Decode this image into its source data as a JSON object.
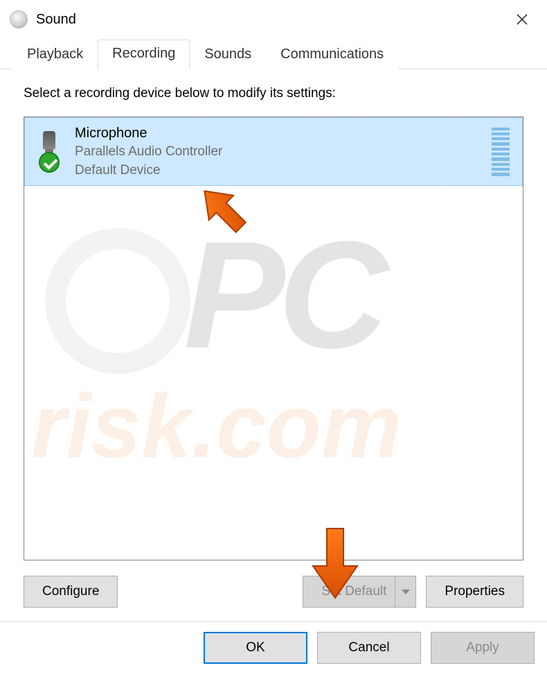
{
  "window": {
    "title": "Sound"
  },
  "tabs": {
    "playback": "Playback",
    "recording": "Recording",
    "sounds": "Sounds",
    "communications": "Communications",
    "active": "recording"
  },
  "instruction": "Select a recording device below to modify its settings:",
  "device": {
    "name": "Microphone",
    "controller": "Parallels Audio Controller",
    "status": "Default Device"
  },
  "buttons": {
    "configure": "Configure",
    "set_default": "Set Default",
    "properties": "Properties",
    "ok": "OK",
    "cancel": "Cancel",
    "apply": "Apply"
  }
}
